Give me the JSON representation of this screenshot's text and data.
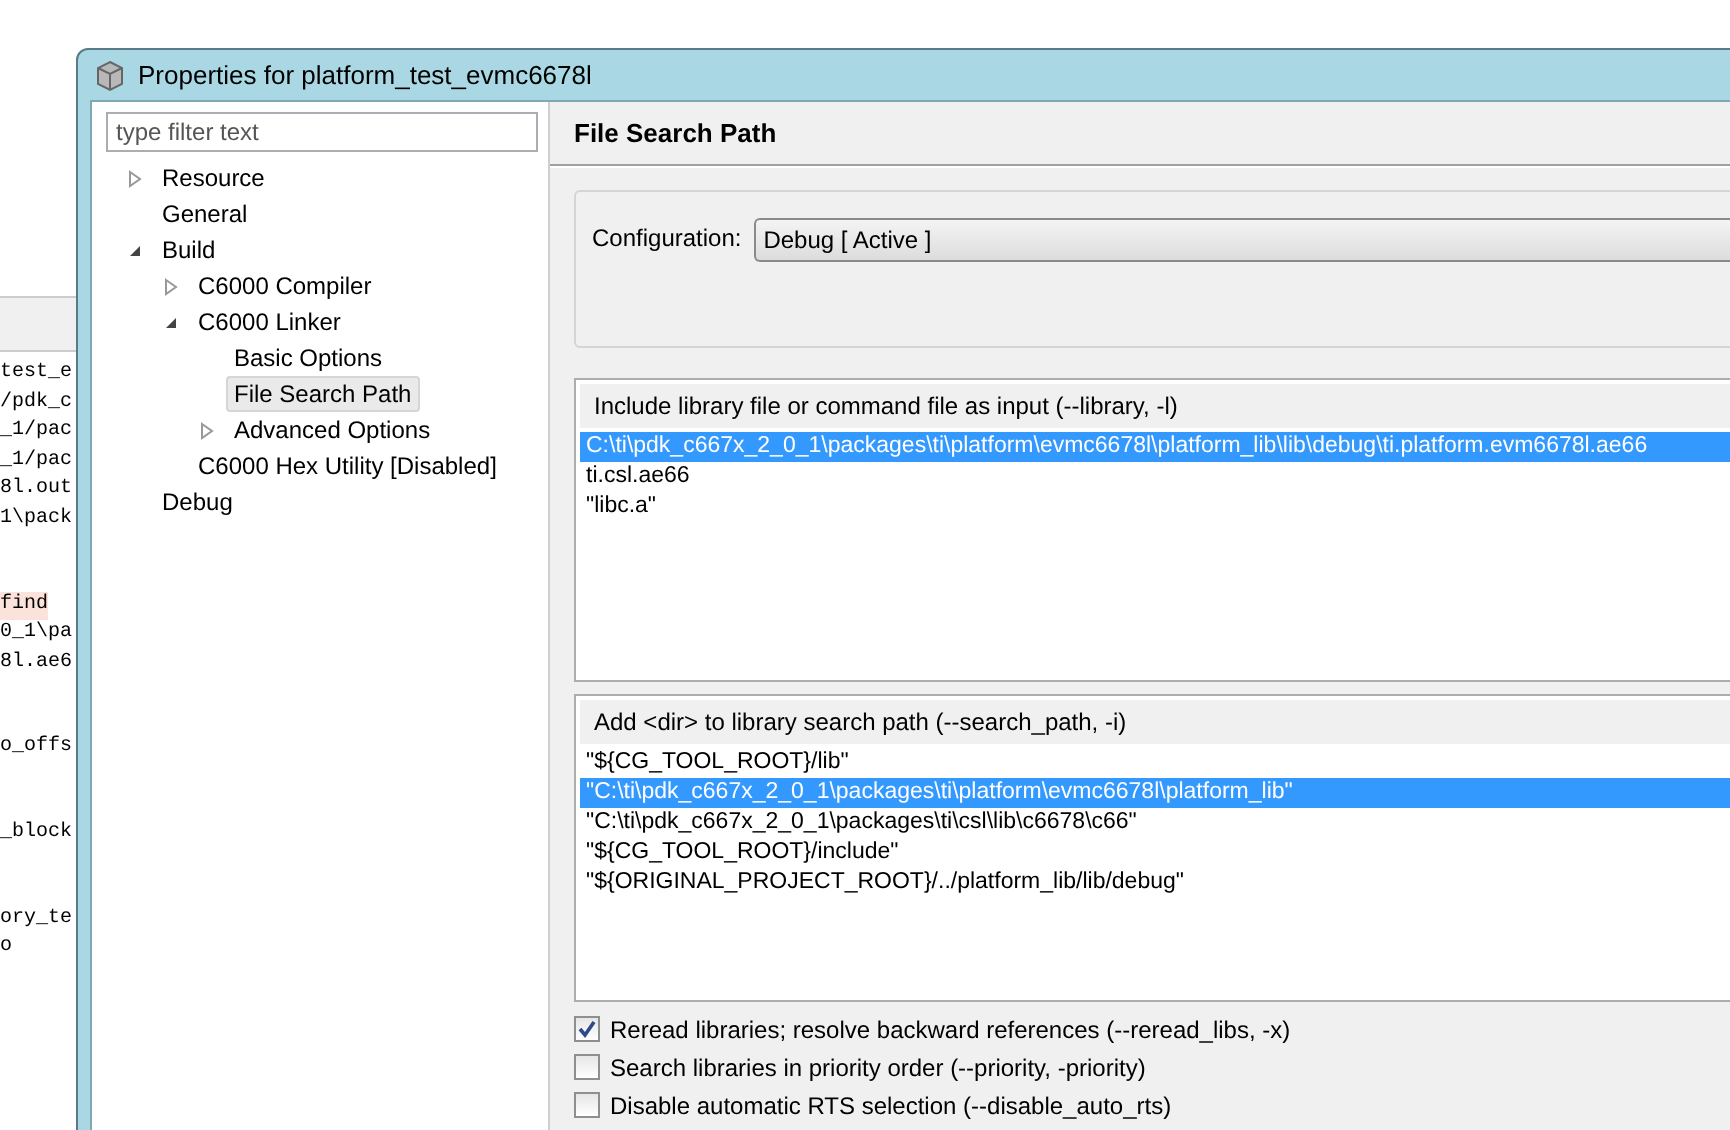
{
  "background_editor": {
    "line_groups": [
      [
        {
          "text": "test_e",
          "highlighted": false
        },
        {
          "text": "/pdk_c",
          "highlighted": false
        },
        {
          "text": "_1/pac",
          "highlighted": false
        },
        {
          "text": "_1/pac",
          "highlighted": false
        },
        {
          "text": "8l.out",
          "highlighted": false
        },
        {
          "text": "1\\pack",
          "highlighted": false
        }
      ],
      [
        {
          "text": "find",
          "highlighted": true
        },
        {
          "text": "0_1\\pa",
          "highlighted": false
        },
        {
          "text": "8l.ae6",
          "highlighted": false
        }
      ],
      [
        {
          "text": "o_offs",
          "highlighted": false
        }
      ],
      [
        {
          "text": "_block",
          "highlighted": false
        }
      ],
      [
        {
          "text": "ory_te",
          "highlighted": false
        },
        {
          "text": "o",
          "highlighted": false
        }
      ]
    ]
  },
  "window": {
    "title": "Properties for platform_test_evmc6678l"
  },
  "filter": {
    "placeholder": "type filter text"
  },
  "tree": [
    {
      "label": "Resource",
      "expanded": false,
      "selected": false
    },
    {
      "label": "General",
      "selected": false
    },
    {
      "label": "Build",
      "expanded": true,
      "selected": false,
      "children": [
        {
          "label": "C6000 Compiler",
          "expanded": false,
          "selected": false
        },
        {
          "label": "C6000 Linker",
          "expanded": true,
          "selected": false,
          "children": [
            {
              "label": "Basic Options",
              "selected": false
            },
            {
              "label": "File Search Path",
              "selected": true
            },
            {
              "label": "Advanced Options",
              "expanded": false,
              "selected": false
            }
          ]
        },
        {
          "label": "C6000 Hex Utility  [Disabled]",
          "selected": false
        }
      ]
    },
    {
      "label": "Debug",
      "selected": false
    }
  ],
  "page_title": "File Search Path",
  "configuration": {
    "label": "Configuration:",
    "value": "Debug  [ Active ]"
  },
  "lists": [
    {
      "header": "Include library file or command file as input (--library, -l)",
      "items": [
        {
          "text": "C:\\ti\\pdk_c667x_2_0_1\\packages\\ti\\platform\\evmc6678l\\platform_lib\\lib\\debug\\ti.platform.evm6678l.ae66",
          "selected": true
        },
        {
          "text": "ti.csl.ae66",
          "selected": false
        },
        {
          "text": "\"libc.a\"",
          "selected": false
        }
      ]
    },
    {
      "header": "Add <dir> to library search path (--search_path, -i)",
      "items": [
        {
          "text": "\"${CG_TOOL_ROOT}/lib\"",
          "selected": false
        },
        {
          "text": "\"C:\\ti\\pdk_c667x_2_0_1\\packages\\ti\\platform\\evmc6678l\\platform_lib\"",
          "selected": true
        },
        {
          "text": "\"C:\\ti\\pdk_c667x_2_0_1\\packages\\ti\\csl\\lib\\c6678\\c66\"",
          "selected": false
        },
        {
          "text": "\"${CG_TOOL_ROOT}/include\"",
          "selected": false
        },
        {
          "text": "\"${ORIGINAL_PROJECT_ROOT}/../platform_lib/lib/debug\"",
          "selected": false
        }
      ]
    }
  ],
  "options": [
    {
      "label": "Reread libraries; resolve backward references (--reread_libs, -x)",
      "checked": true
    },
    {
      "label": "Search libraries in priority order (--priority, -priority)",
      "checked": false
    },
    {
      "label": "Disable automatic RTS selection (--disable_auto_rts)",
      "checked": false
    }
  ]
}
